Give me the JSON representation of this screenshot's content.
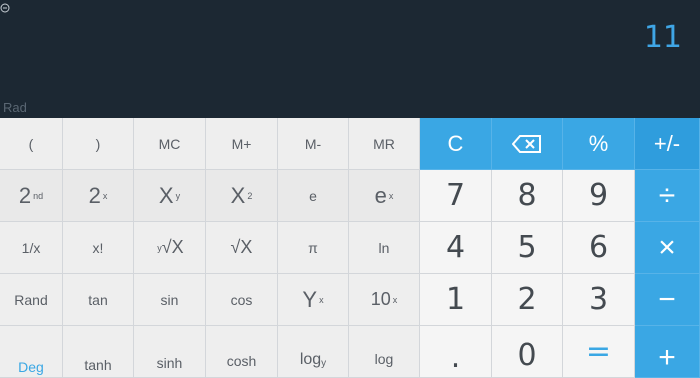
{
  "display": {
    "result": "11",
    "angle_mode": "Rad"
  },
  "memory": {
    "mc": "MC",
    "mplus": "M+",
    "mminus": "M-",
    "mr": "MR"
  },
  "sci": {
    "lparen": "(",
    "rparen": ")",
    "second": "2",
    "second_sup": "nd",
    "two_pow": "2",
    "two_pow_sup": "x",
    "x_pow_y": "X",
    "x_pow_y_sup": "y",
    "x_sq": "X",
    "x_sq_sup": "2",
    "e": "e",
    "e_pow": "e",
    "e_pow_sup": "x",
    "recip": "1/x",
    "fact": "x!",
    "yroot": "√X",
    "yroot_pre": "y",
    "sqrt": "√X",
    "pi": "π",
    "ln": "ln",
    "rand": "Rand",
    "tan": "tan",
    "sin": "sin",
    "cos": "cos",
    "y_pow": "Y",
    "y_pow_sup": "x",
    "ten_pow": "10",
    "ten_pow_sup": "x",
    "deg": "Deg",
    "tanh": "tanh",
    "sinh": "sinh",
    "cosh": "cosh",
    "logy": "log",
    "logy_sub": "y",
    "log": "log"
  },
  "ops": {
    "clear": "C",
    "percent": "%",
    "plusminus": "+/-",
    "divide": "÷",
    "multiply": "×",
    "minus": "−",
    "plus": "+",
    "equals": "=",
    "dot": "."
  },
  "digits": {
    "d0": "0",
    "d1": "1",
    "d2": "2",
    "d3": "3",
    "d4": "4",
    "d5": "5",
    "d6": "6",
    "d7": "7",
    "d8": "8",
    "d9": "9"
  }
}
